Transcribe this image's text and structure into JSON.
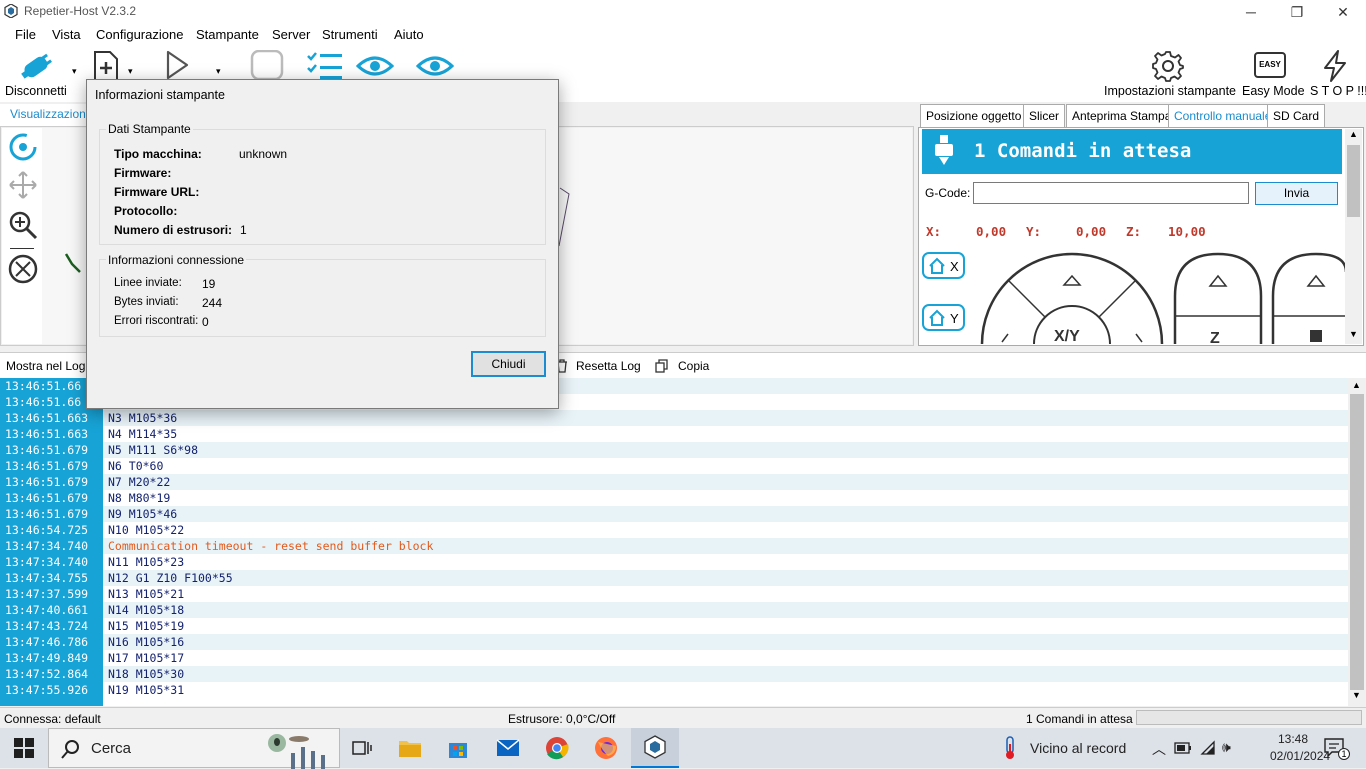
{
  "window": {
    "title": "Repetier-Host V2.3.2"
  },
  "menu": [
    "File",
    "Vista",
    "Configurazione",
    "Stampante",
    "Server",
    "Strumenti",
    "Aiuto"
  ],
  "toolbar": {
    "connect_label": "Disconnetti",
    "printer_settings_label": "Impostazioni stampante",
    "easy_mode_label": "Easy Mode",
    "easy_badge": "EASY",
    "stop_label": "S T O P !!!"
  },
  "view": {
    "tab_label": "Visualizzazione"
  },
  "right_tabs": [
    "Posizione oggetto",
    "Slicer",
    "Anteprima Stampa",
    "Controllo manuale",
    "SD Card"
  ],
  "manual": {
    "banner": "1 Comandi in attesa",
    "gcode_label": "G-Code:",
    "gcode_value": "",
    "send_label": "Invia",
    "x_label": "X:",
    "x_value": "0,00",
    "y_label": "Y:",
    "y_value": "0,00",
    "z_label": "Z:",
    "z_value": "10,00",
    "home_x": "X",
    "home_y": "Y",
    "xy_label": "X/Y",
    "z_jog_label": "Z"
  },
  "logbar": {
    "show_label": "Mostra nel Log:",
    "reset_label": "Resetta Log",
    "copy_label": "Copia"
  },
  "log": [
    {
      "t": "13:46:51.66",
      "m": "",
      "err": false
    },
    {
      "t": "13:46:51.66",
      "m": "",
      "err": false
    },
    {
      "t": "13:46:51.663",
      "m": "N3 M105*36",
      "err": false
    },
    {
      "t": "13:46:51.663",
      "m": "N4 M114*35",
      "err": false
    },
    {
      "t": "13:46:51.679",
      "m": "N5 M111 S6*98",
      "err": false
    },
    {
      "t": "13:46:51.679",
      "m": "N6 T0*60",
      "err": false
    },
    {
      "t": "13:46:51.679",
      "m": "N7 M20*22",
      "err": false
    },
    {
      "t": "13:46:51.679",
      "m": "N8 M80*19",
      "err": false
    },
    {
      "t": "13:46:51.679",
      "m": "N9 M105*46",
      "err": false
    },
    {
      "t": "13:46:54.725",
      "m": "N10 M105*22",
      "err": false
    },
    {
      "t": "13:47:34.740",
      "m": "Communication timeout - reset send buffer block",
      "err": true
    },
    {
      "t": "13:47:34.740",
      "m": "N11 M105*23",
      "err": false
    },
    {
      "t": "13:47:34.755",
      "m": "N12 G1 Z10 F100*55",
      "err": false
    },
    {
      "t": "13:47:37.599",
      "m": "N13 M105*21",
      "err": false
    },
    {
      "t": "13:47:40.661",
      "m": "N14 M105*18",
      "err": false
    },
    {
      "t": "13:47:43.724",
      "m": "N15 M105*19",
      "err": false
    },
    {
      "t": "13:47:46.786",
      "m": "N16 M105*16",
      "err": false
    },
    {
      "t": "13:47:49.849",
      "m": "N17 M105*17",
      "err": false
    },
    {
      "t": "13:47:52.864",
      "m": "N18 M105*30",
      "err": false
    },
    {
      "t": "13:47:55.926",
      "m": "N19 M105*31",
      "err": false
    }
  ],
  "status": {
    "connection": "Connessa: default",
    "extruder": "Estrusore: 0,0°C/Off",
    "queue": "1 Comandi in attesa"
  },
  "taskbar": {
    "search_placeholder": "Cerca",
    "weather": "Vicino al record",
    "time": "13:48",
    "date": "02/01/2024",
    "notification_count": "1"
  },
  "dialog": {
    "title": "Informazioni stampante",
    "group1_title": "Dati Stampante",
    "machine_type_label": "Tipo macchina:",
    "machine_type_value": "unknown",
    "firmware_label": "Firmware:",
    "firmware_value": "",
    "firmware_url_label": "Firmware URL:",
    "firmware_url_value": "",
    "protocol_label": "Protocollo:",
    "protocol_value": "",
    "extruders_label": "Numero di estrusori:",
    "extruders_value": "1",
    "group2_title": "Informazioni connessione",
    "lines_sent_label": "Linee inviate:",
    "lines_sent_value": "19",
    "bytes_sent_label": "Bytes inviati:",
    "bytes_sent_value": "244",
    "errors_label": "Errori riscontrati:",
    "errors_value": "0",
    "close_label": "Chiudi"
  },
  "colors": {
    "accent": "#17a3d6",
    "error": "#e25a1c",
    "log_text": "#14226e",
    "coord": "#c0392b"
  }
}
